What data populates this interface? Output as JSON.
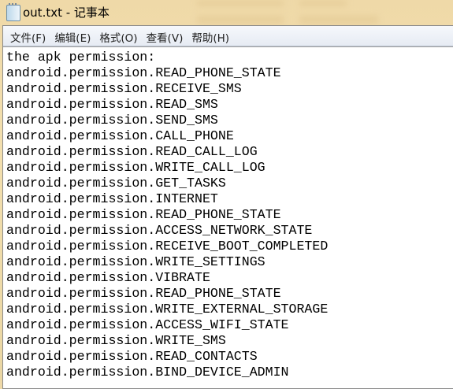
{
  "window": {
    "title": "out.txt - 记事本"
  },
  "menu": [
    "文件(F)",
    "编辑(E)",
    "格式(O)",
    "查看(V)",
    "帮助(H)"
  ],
  "lines": [
    "the apk permission:",
    "android.permission.READ_PHONE_STATE",
    "android.permission.RECEIVE_SMS",
    "android.permission.READ_SMS",
    "android.permission.SEND_SMS",
    "android.permission.CALL_PHONE",
    "android.permission.READ_CALL_LOG",
    "android.permission.WRITE_CALL_LOG",
    "android.permission.GET_TASKS",
    "android.permission.INTERNET",
    "android.permission.READ_PHONE_STATE",
    "android.permission.ACCESS_NETWORK_STATE",
    "android.permission.RECEIVE_BOOT_COMPLETED",
    "android.permission.WRITE_SETTINGS",
    "android.permission.VIBRATE",
    "android.permission.READ_PHONE_STATE",
    "android.permission.WRITE_EXTERNAL_STORAGE",
    "android.permission.ACCESS_WIFI_STATE",
    "android.permission.WRITE_SMS",
    "android.permission.READ_CONTACTS",
    "android.permission.BIND_DEVICE_ADMIN"
  ]
}
